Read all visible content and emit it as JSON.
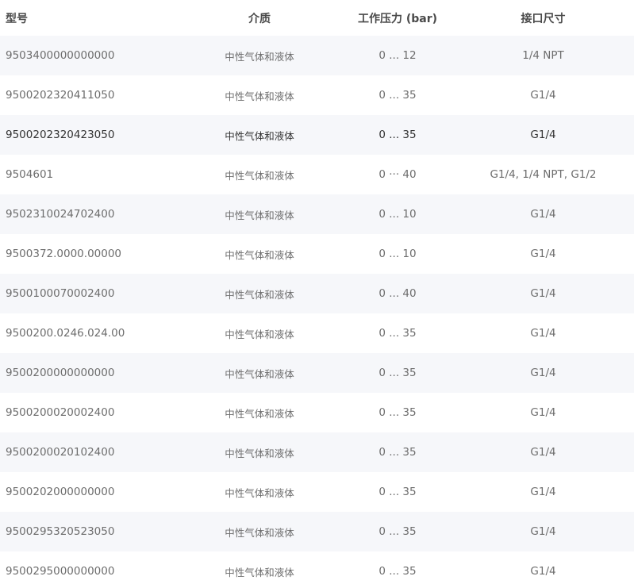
{
  "headers": {
    "model": "型号",
    "medium": "介质",
    "pressure": "工作压力 (bar)",
    "port": "接口尺寸"
  },
  "rows": [
    {
      "model": "9503400000000000",
      "medium": "中性气体和液体",
      "pressure": "0 ... 12",
      "port": "1/4 NPT"
    },
    {
      "model": "9500202320411050",
      "medium": "中性气体和液体",
      "pressure": "0 ... 35",
      "port": "G1/4"
    },
    {
      "model": "9500202320423050",
      "medium": "中性气体和液体",
      "pressure": "0 ... 35",
      "port": "G1/4"
    },
    {
      "model": "9504601",
      "medium": "中性气体和液体",
      "pressure": "0 ··· 40",
      "port": "G1/4, 1/4 NPT, G1/2"
    },
    {
      "model": "9502310024702400",
      "medium": "中性气体和液体",
      "pressure": "0 ... 10",
      "port": "G1/4"
    },
    {
      "model": "9500372.0000.00000",
      "medium": "中性气体和液体",
      "pressure": "0 ... 10",
      "port": "G1/4"
    },
    {
      "model": "9500100070002400",
      "medium": "中性气体和液体",
      "pressure": "0 ... 40",
      "port": "G1/4"
    },
    {
      "model": "9500200.0246.024.00",
      "medium": "中性气体和液体",
      "pressure": "0 ... 35",
      "port": "G1/4"
    },
    {
      "model": "9500200000000000",
      "medium": "中性气体和液体",
      "pressure": "0 ... 35",
      "port": "G1/4"
    },
    {
      "model": "9500200020002400",
      "medium": "中性气体和液体",
      "pressure": "0 ... 35",
      "port": "G1/4"
    },
    {
      "model": "9500200020102400",
      "medium": "中性气体和液体",
      "pressure": "0 ... 35",
      "port": "G1/4"
    },
    {
      "model": "9500202000000000",
      "medium": "中性气体和液体",
      "pressure": "0 ... 35",
      "port": "G1/4"
    },
    {
      "model": "9500295320523050",
      "medium": "中性气体和液体",
      "pressure": "0 ... 35",
      "port": "G1/4"
    },
    {
      "model": "9500295000000000",
      "medium": "中性气体和液体",
      "pressure": "0 ... 35",
      "port": "G1/4"
    }
  ],
  "colors": {
    "header_text": "#4a4a4a",
    "row_text": "#6d6d6d",
    "highlight_text": "#333333",
    "alt_row_bg": "#f6f7fa"
  }
}
